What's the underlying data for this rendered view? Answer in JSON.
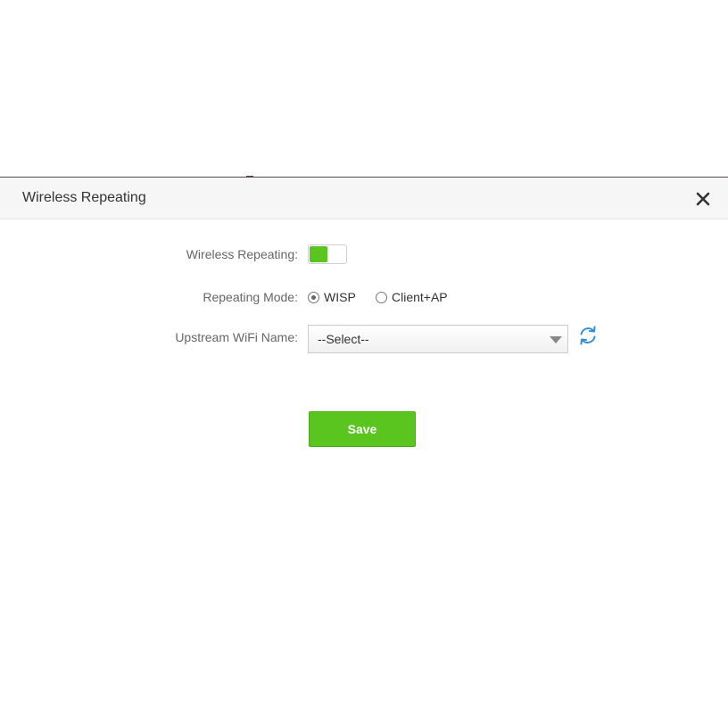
{
  "dialog": {
    "title": "Wireless Repeating"
  },
  "form": {
    "wireless_repeating": {
      "label": "Wireless Repeating:",
      "enabled": true
    },
    "repeating_mode": {
      "label": "Repeating Mode:",
      "options": [
        {
          "label": "WISP",
          "selected": true
        },
        {
          "label": "Client+AP",
          "selected": false
        }
      ]
    },
    "upstream_wifi": {
      "label": "Upstream WiFi Name:",
      "selected_value": "--Select--"
    },
    "save_label": "Save"
  },
  "colors": {
    "accent_green": "#5ac51f",
    "refresh_blue": "#2f8fd8",
    "label_gray": "#666666"
  },
  "icons": {
    "close": "close-icon",
    "refresh": "refresh-icon",
    "dropdown": "chevron-down-icon"
  }
}
